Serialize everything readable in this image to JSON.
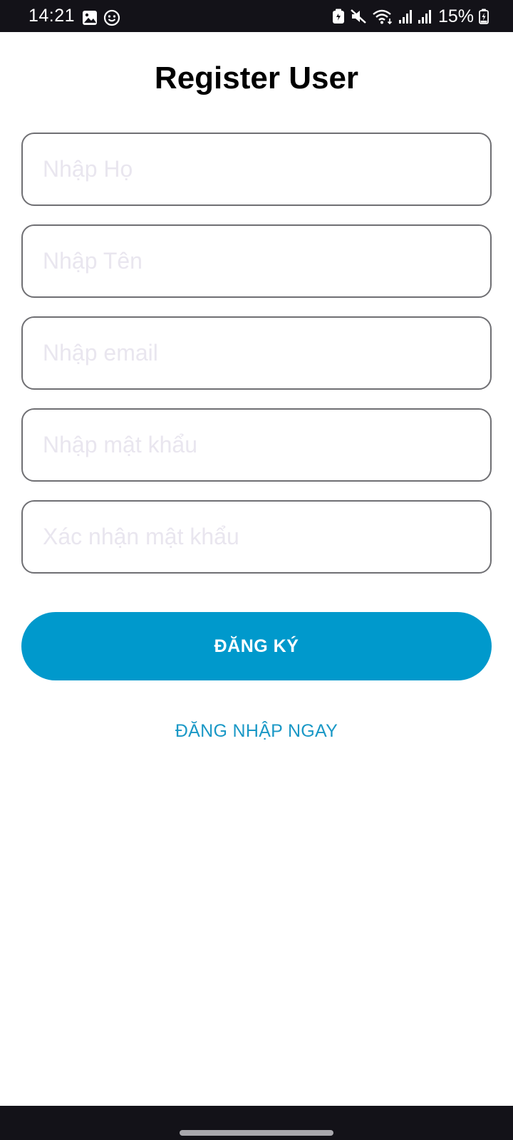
{
  "status_bar": {
    "time": "14:21",
    "battery": "15%",
    "left_icons": [
      "image-icon",
      "smiley-icon"
    ],
    "right_icons": [
      "battery-saver-icon",
      "mute-icon",
      "wifi-icon",
      "signal-icon",
      "signal-icon-2",
      "battery-icon"
    ]
  },
  "page": {
    "title": "Register User"
  },
  "form": {
    "last_name_placeholder": "Nhập Họ",
    "first_name_placeholder": "Nhập Tên",
    "email_placeholder": "Nhập email",
    "password_placeholder": "Nhập mật khẩu",
    "confirm_password_placeholder": "Xác nhận mật khẩu"
  },
  "actions": {
    "register_label": "ĐĂNG KÝ",
    "login_link_label": "ĐĂNG NHẬP NGAY"
  },
  "colors": {
    "accent": "#0099cc",
    "link": "#1a98c6",
    "placeholder": "#e9e6ef",
    "system_bar": "#131218"
  }
}
